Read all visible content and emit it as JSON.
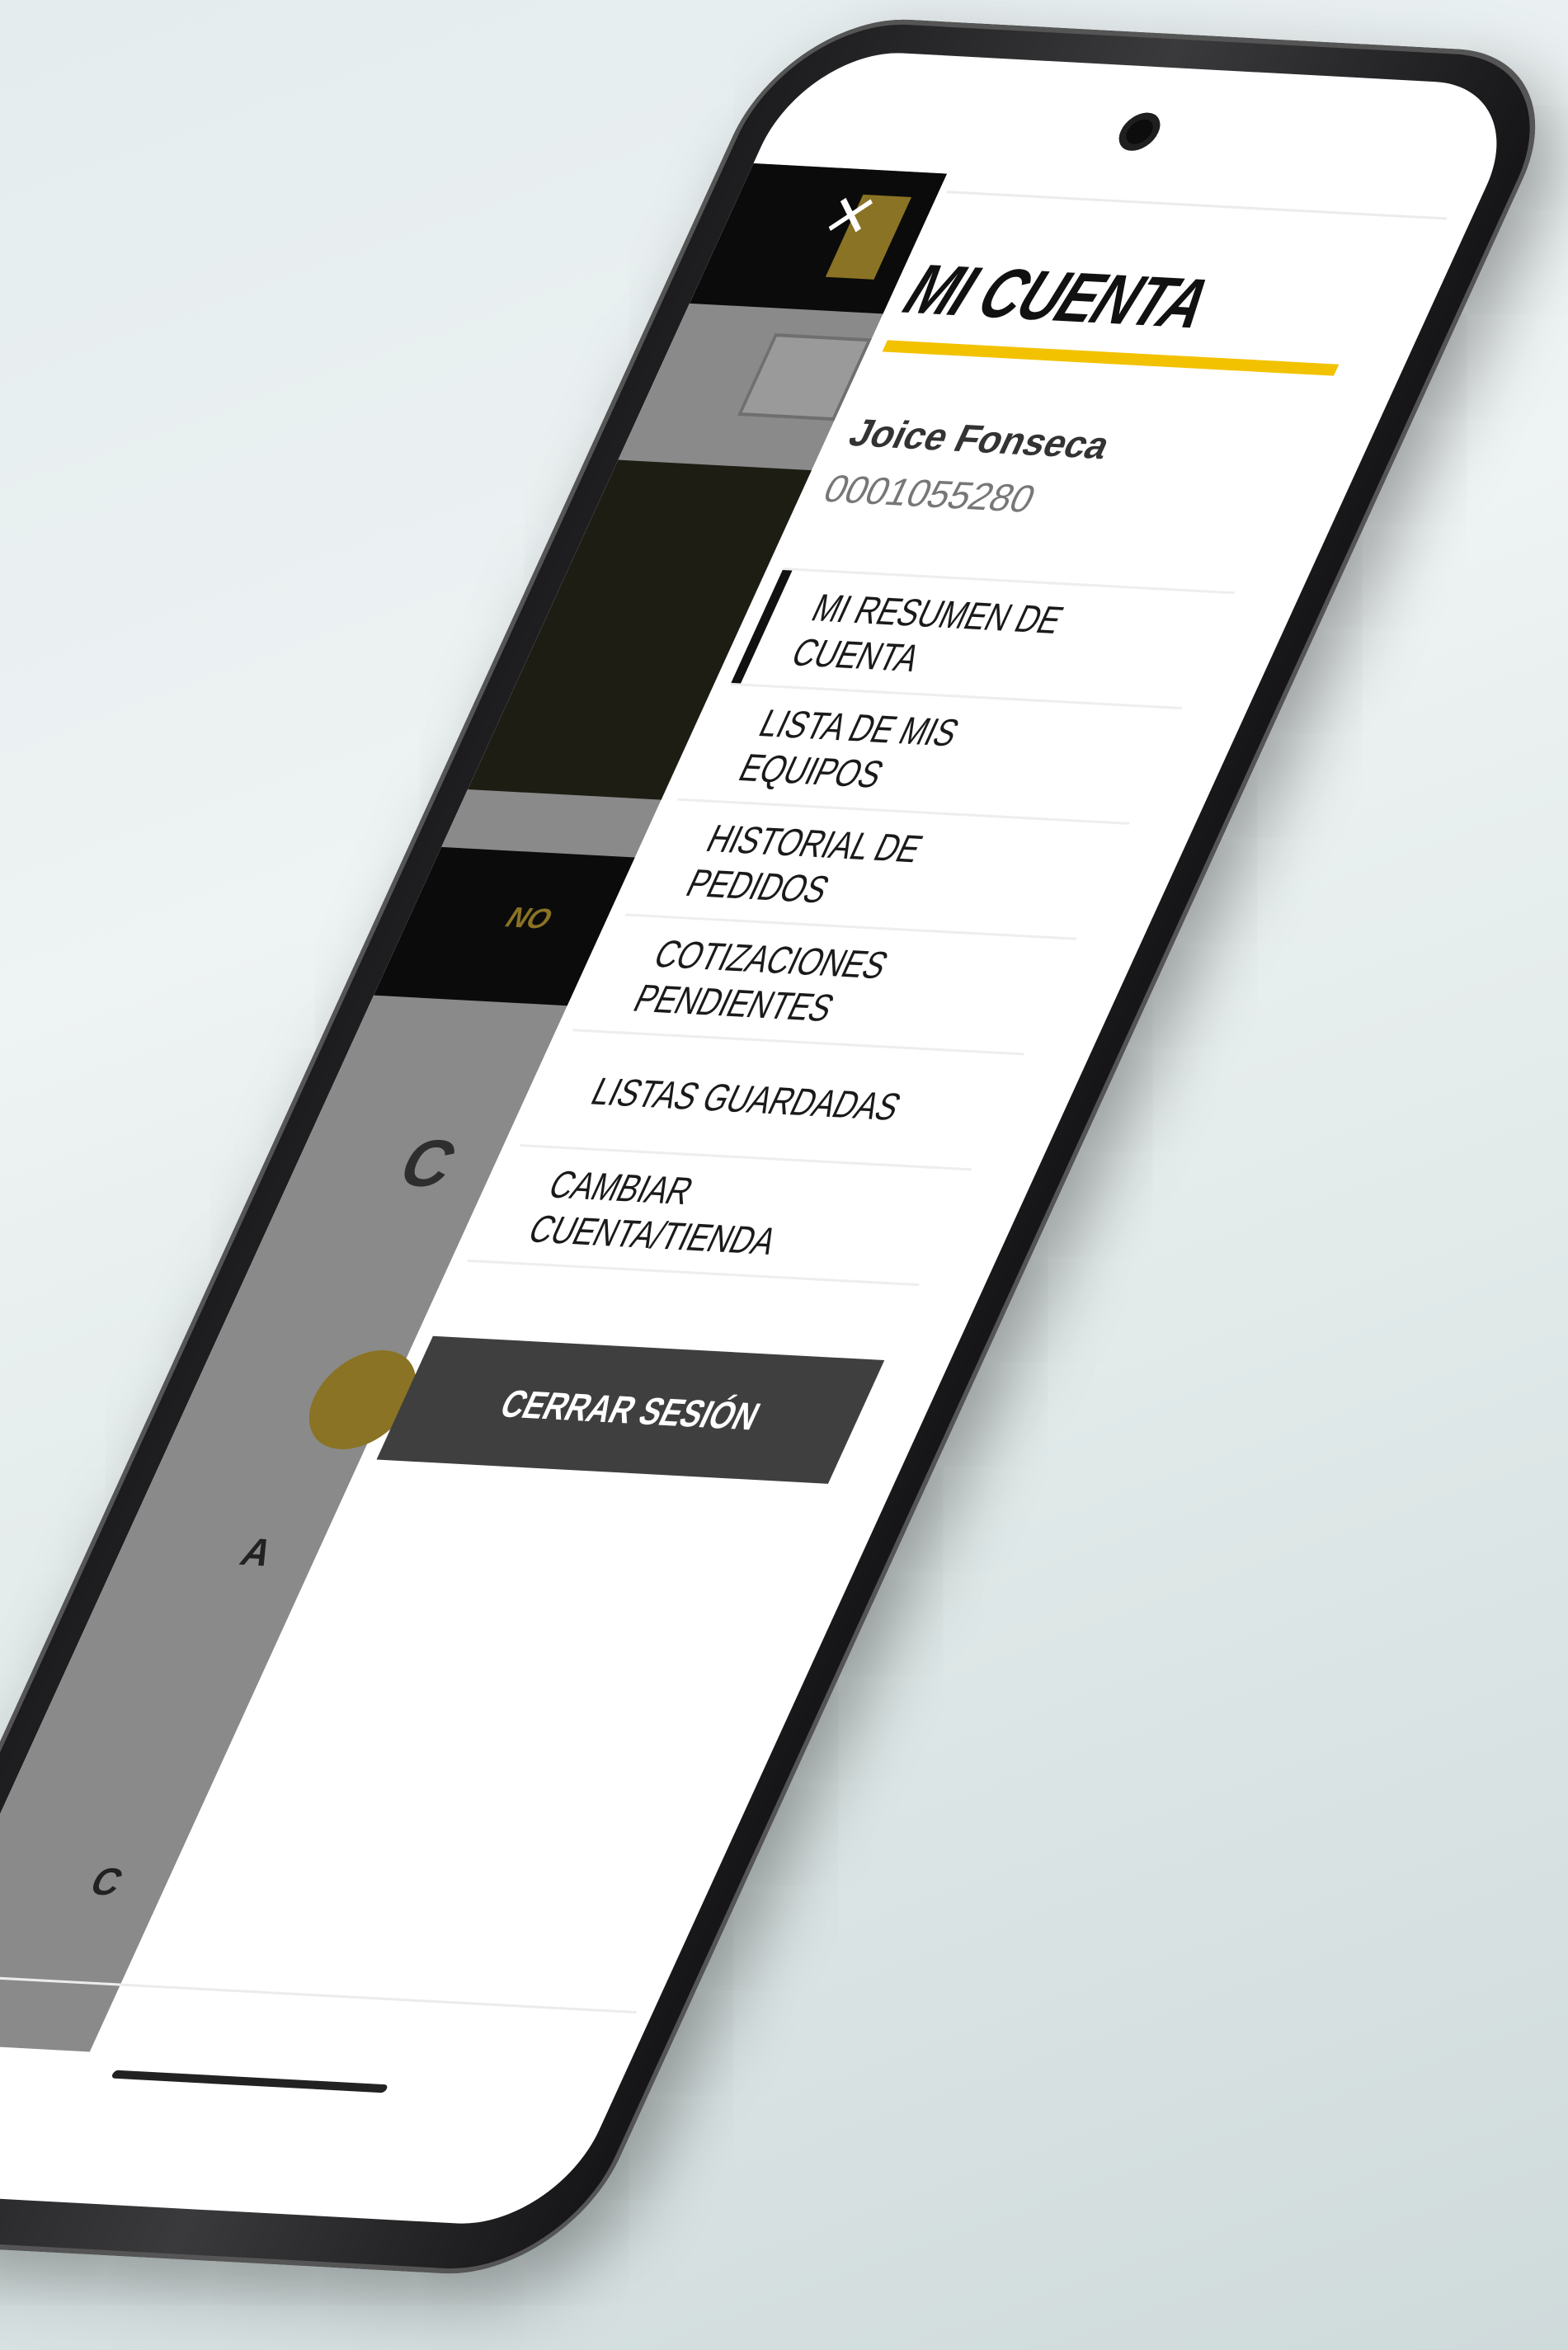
{
  "drawer": {
    "close_label": "×",
    "title": "MI CUENTA",
    "user": {
      "name": "Joice Fonseca",
      "account_id": "0001055280"
    },
    "menu": [
      {
        "label": "MI RESUMEN DE CUENTA",
        "active": true
      },
      {
        "label": "LISTA DE MIS EQUIPOS",
        "active": false
      },
      {
        "label": "HISTORIAL DE PEDIDOS",
        "active": false
      },
      {
        "label": "COTIZACIONES PENDIENTES",
        "active": false
      },
      {
        "label": "LISTAS GUARDADAS",
        "active": false
      },
      {
        "label": "CAMBIAR CUENTA/TIENDA",
        "active": false
      }
    ],
    "logout_label": "CERRAR SESIÓN"
  },
  "background_page": {
    "notice_fragment": "NO",
    "letter_1": "C",
    "letter_2": "A",
    "letter_3": "C"
  },
  "colors": {
    "accent": "#f2c200",
    "logout_bg": "#3f3f3f",
    "phone_frame": "#1c1c1e"
  }
}
